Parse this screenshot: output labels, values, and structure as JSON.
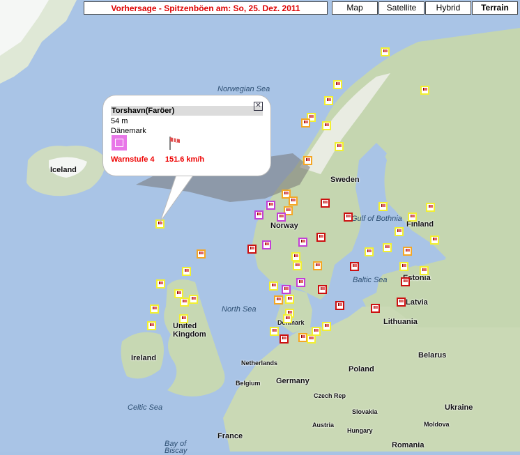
{
  "title": "Vorhersage - Spitzenböen am: So, 25. Dez. 2011",
  "map_types": [
    {
      "label": "Map",
      "active": false
    },
    {
      "label": "Satellite",
      "active": false
    },
    {
      "label": "Hybrid",
      "active": false
    },
    {
      "label": "Terrain",
      "active": true
    }
  ],
  "popup": {
    "station": "Torshavn(Faröer)",
    "altitude": "54 m",
    "country": "Dänemark",
    "warning_level": "Warnstufe 4",
    "gust": "151.6",
    "unit": "km/h"
  },
  "labels": {
    "iceland": "Iceland",
    "norwegian_sea": "Norwegian Sea",
    "sweden": "Sweden",
    "norway": "Norway",
    "finland": "Finland",
    "gulf_of_bothnia": "Gulf of Bothnia",
    "estonia": "Estonia",
    "baltic_sea": "Baltic Sea",
    "latvia": "Latvia",
    "north_sea": "North Sea",
    "lithuania": "Lithuania",
    "denmark": "Denmark",
    "united_kingdom": "United Kingdom",
    "ireland": "Ireland",
    "belarus": "Belarus",
    "netherlands": "Netherlands",
    "poland": "Poland",
    "belgium": "Belgium",
    "germany": "Germany",
    "czech_rep": "Czech Rep",
    "ukraine": "Ukraine",
    "slovakia": "Slovakia",
    "celtic_sea": "Celtic Sea",
    "austria": "Austria",
    "hungary": "Hungary",
    "moldova": "Moldova",
    "france": "France",
    "romania": "Romania",
    "bay_of_biscay": "Bay of Biscay"
  },
  "colors": {
    "level1": "#f2ef32",
    "level2": "#f5a623",
    "level3": "#cc1010",
    "level4": "#c33fd6",
    "title_red": "#dd0000"
  },
  "icons": [
    "close-icon",
    "wind-flag-icon",
    "warning-level-4-icon"
  ],
  "stations": [
    {
      "level": 1
    },
    {
      "level": 1
    },
    {
      "level": 1
    },
    {
      "level": 1
    },
    {
      "level": 1
    },
    {
      "level": 1
    },
    {
      "level": 2
    },
    {
      "level": 1
    },
    {
      "level": 2
    },
    {
      "level": 2
    },
    {
      "level": 2
    },
    {
      "level": 4
    },
    {
      "level": 3
    },
    {
      "level": 2
    },
    {
      "level": 4
    },
    {
      "level": 4
    },
    {
      "level": 3
    },
    {
      "level": 1
    },
    {
      "level": 1
    },
    {
      "level": 1
    },
    {
      "level": 1
    },
    {
      "level": 1
    },
    {
      "level": 4
    },
    {
      "level": 3
    },
    {
      "level": 4
    },
    {
      "level": 3
    },
    {
      "level": 1
    },
    {
      "level": 2
    },
    {
      "level": 3
    },
    {
      "level": 1
    },
    {
      "level": 1
    },
    {
      "level": 2
    },
    {
      "level": 1
    },
    {
      "level": 1
    },
    {
      "level": 1
    },
    {
      "level": 3
    },
    {
      "level": 1
    },
    {
      "level": 4
    },
    {
      "level": 4
    },
    {
      "level": 3
    },
    {
      "level": 3
    },
    {
      "level": 3
    },
    {
      "level": 3
    },
    {
      "level": 2
    },
    {
      "level": 1
    },
    {
      "level": 1
    },
    {
      "level": 1
    },
    {
      "level": 3
    },
    {
      "level": 2
    },
    {
      "level": 1
    },
    {
      "level": 1
    },
    {
      "level": 1
    },
    {
      "level": 1
    },
    {
      "level": 1
    },
    {
      "level": 2
    },
    {
      "level": 1
    },
    {
      "level": 1
    },
    {
      "level": 1
    },
    {
      "level": 1
    },
    {
      "level": 1
    },
    {
      "level": 1
    },
    {
      "level": 1
    },
    {
      "level": 1
    }
  ]
}
